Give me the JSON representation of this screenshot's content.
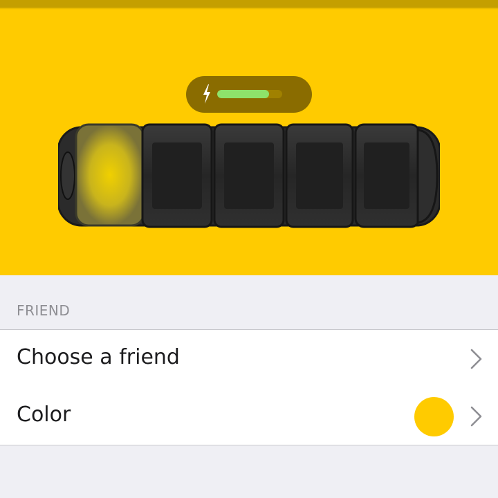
{
  "device": {
    "battery_level": 0.8,
    "accent_color": "#ffcb00",
    "battery_fill_color": "#8ee36a"
  },
  "section": {
    "header": "FRIEND"
  },
  "rows": {
    "friend": {
      "label": "Choose a friend",
      "icon": "chevron-right-icon"
    },
    "color": {
      "label": "Color",
      "swatch_color": "#ffcb00",
      "icon": "chevron-right-icon"
    }
  }
}
